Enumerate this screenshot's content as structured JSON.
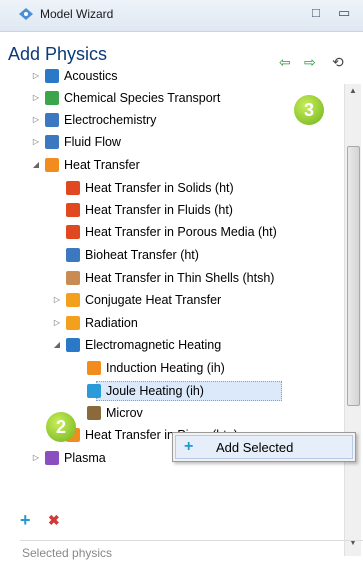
{
  "window": {
    "title": "Model Wizard",
    "controls": [
      "□",
      "▭"
    ]
  },
  "panel": {
    "title": "Add Physics",
    "nav": [
      "⇦",
      "⇨",
      "⟲"
    ]
  },
  "tree": [
    {
      "label": "Acoustics",
      "expander": "▷",
      "icon_color": "#2a78c8"
    },
    {
      "label": "Chemical Species Transport",
      "expander": "▷",
      "icon_color": "#3aa54b"
    },
    {
      "label": "Electrochemistry",
      "expander": "▷",
      "icon_color": "#3c78c0"
    },
    {
      "label": "Fluid Flow",
      "expander": "▷",
      "icon_color": "#3c78c0"
    },
    {
      "label": "Heat Transfer",
      "expander": "◢",
      "icon_color": "#f28c1e"
    },
    {
      "label": "Heat Transfer in Solids (ht)",
      "icon_color": "#e0481f"
    },
    {
      "label": "Heat Transfer in Fluids (ht)",
      "icon_color": "#e0481f"
    },
    {
      "label": "Heat Transfer in Porous Media (ht)",
      "icon_color": "#e0481f"
    },
    {
      "label": "Bioheat Transfer (ht)",
      "icon_color": "#3c78c0"
    },
    {
      "label": "Heat Transfer in Thin Shells (htsh)",
      "icon_color": "#c88b52"
    },
    {
      "label": "Conjugate Heat Transfer",
      "expander": "▷",
      "icon_color": "#f2a01e"
    },
    {
      "label": "Radiation",
      "expander": "▷",
      "icon_color": "#f2a01e"
    },
    {
      "label": "Electromagnetic Heating",
      "expander": "◢",
      "icon_color": "#2a78c8"
    },
    {
      "label": "Induction Heating (ih)",
      "icon_color": "#f28c1e"
    },
    {
      "label": "Joule Heating (ih)",
      "icon_color": "#2a9ad8",
      "selected": true
    },
    {
      "label": "Microv",
      "icon_color": "#8a6a3a"
    },
    {
      "label": "Heat Transfer in Pipes (htp)",
      "icon_color": "#f28c1e"
    },
    {
      "label": "Plasma",
      "expander": "▷",
      "icon_color": "#8a4ec0"
    }
  ],
  "badges": [
    "3",
    "2"
  ],
  "context_menu": {
    "item": "Add Selected",
    "icon": "+"
  },
  "bottom": {
    "add_icon": "+",
    "remove_icon": "✖",
    "selected_physics_label": "Selected physics"
  }
}
